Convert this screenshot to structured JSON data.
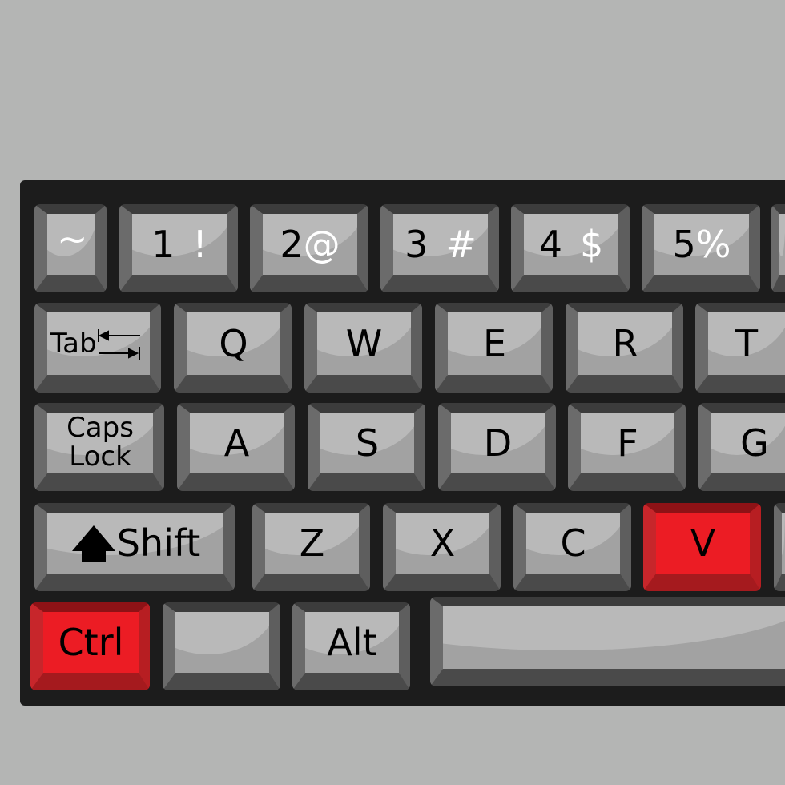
{
  "colors": {
    "background": "#b4b5b4",
    "keyboard": "#1c1c1c",
    "key_face": "#a2a2a2",
    "highlight_key": "#ec1c24"
  },
  "row1": [
    {
      "main": "",
      "alt": "~"
    },
    {
      "main": "1",
      "alt": "!"
    },
    {
      "main": "2",
      "alt": "@"
    },
    {
      "main": "3",
      "alt": "#"
    },
    {
      "main": "4",
      "alt": "$"
    },
    {
      "main": "5",
      "alt": "%"
    }
  ],
  "row2": [
    "Tab",
    "Q",
    "W",
    "E",
    "R",
    "T"
  ],
  "row3": [
    "Caps",
    "Lock",
    "A",
    "S",
    "D",
    "F",
    "G"
  ],
  "row4": [
    "Shift",
    "Z",
    "X",
    "C",
    "V"
  ],
  "row5": [
    "Ctrl",
    "",
    "Alt",
    ""
  ],
  "highlighted": [
    "Ctrl",
    "V"
  ]
}
